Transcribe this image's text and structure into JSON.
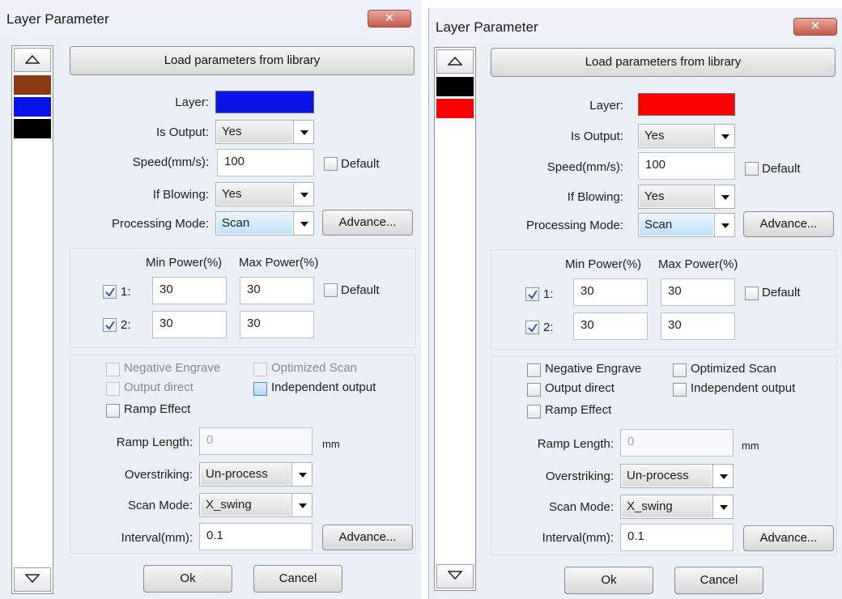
{
  "dialogs": [
    {
      "title": "Layer Parameter",
      "close_label": "✕",
      "layer_swatches": [
        "#8b3a12",
        "#0a14e8",
        "#000000"
      ],
      "load_button": "Load parameters from library",
      "layer_label": "Layer:",
      "layer_color": "#0a14e8",
      "is_output_label": "Is Output:",
      "is_output_value": "Yes",
      "speed_label": "Speed(mm/s):",
      "speed_value": "100",
      "default_label": "Default",
      "if_blowing_label": "If Blowing:",
      "if_blowing_value": "Yes",
      "processing_mode_label": "Processing Mode:",
      "processing_mode_value": "Scan",
      "advance_button": "Advance...",
      "min_power_header": "Min Power(%)",
      "max_power_header": "Max Power(%)",
      "power_rows": [
        {
          "label": "1:",
          "min": "30",
          "max": "30",
          "checked": true
        },
        {
          "label": "2:",
          "min": "30",
          "max": "30",
          "checked": true
        }
      ],
      "power_default_label": "Default",
      "negative_engrave": "Negative Engrave",
      "optimized_scan": "Optimized Scan",
      "output_direct": "Output direct",
      "independent_output": "Independent output",
      "ramp_effect": "Ramp Effect",
      "ramp_length_label": "Ramp Length:",
      "ramp_length_value": "0",
      "ramp_length_unit": "mm",
      "overstriking_label": "Overstriking:",
      "overstriking_value": "Un-process",
      "scan_mode_label": "Scan Mode:",
      "scan_mode_value": "X_swing",
      "interval_label": "Interval(mm):",
      "interval_value": "0.1",
      "advance_button_2": "Advance...",
      "ok_button": "Ok",
      "cancel_button": "Cancel"
    },
    {
      "title": "Layer Parameter",
      "close_label": "✕",
      "layer_swatches": [
        "#000000",
        "#ff0000"
      ],
      "load_button": "Load parameters from library",
      "layer_label": "Layer:",
      "layer_color": "#ff0000",
      "is_output_label": "Is Output:",
      "is_output_value": "Yes",
      "speed_label": "Speed(mm/s):",
      "speed_value": "100",
      "default_label": "Default",
      "if_blowing_label": "If Blowing:",
      "if_blowing_value": "Yes",
      "processing_mode_label": "Processing Mode:",
      "processing_mode_value": "Scan",
      "advance_button": "Advance...",
      "min_power_header": "Min Power(%)",
      "max_power_header": "Max Power(%)",
      "power_rows": [
        {
          "label": "1:",
          "min": "30",
          "max": "30",
          "checked": true
        },
        {
          "label": "2:",
          "min": "30",
          "max": "30",
          "checked": true
        }
      ],
      "power_default_label": "Default",
      "negative_engrave": "Negative Engrave",
      "optimized_scan": "Optimized Scan",
      "output_direct": "Output direct",
      "independent_output": "Independent output",
      "ramp_effect": "Ramp Effect",
      "ramp_length_label": "Ramp Length:",
      "ramp_length_value": "0",
      "ramp_length_unit": "mm",
      "overstriking_label": "Overstriking:",
      "overstriking_value": "Un-process",
      "scan_mode_label": "Scan Mode:",
      "scan_mode_value": "X_swing",
      "interval_label": "Interval(mm):",
      "interval_value": "0.1",
      "advance_button_2": "Advance...",
      "ok_button": "Ok",
      "cancel_button": "Cancel"
    }
  ]
}
